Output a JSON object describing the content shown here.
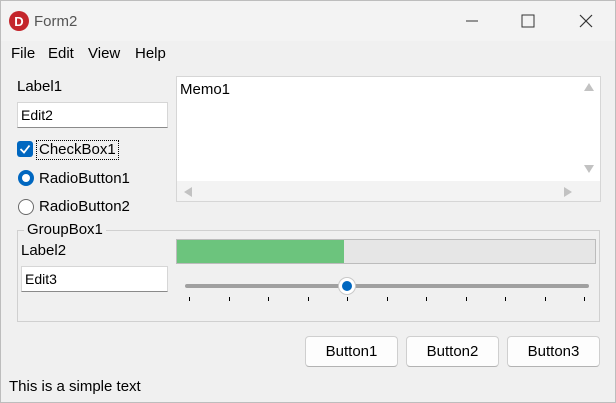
{
  "window": {
    "title": "Form2",
    "app_icon": "D"
  },
  "menu": [
    "File",
    "Edit",
    "View",
    "Help"
  ],
  "label1": "Label1",
  "edit2": "Edit2",
  "checkbox1": {
    "label": "CheckBox1",
    "checked": true
  },
  "radio1": {
    "label": "RadioButton1",
    "selected": true
  },
  "radio2": {
    "label": "RadioButton2",
    "selected": false
  },
  "memo": {
    "text": "Memo1"
  },
  "groupbox": {
    "title": "GroupBox1",
    "label2": "Label2",
    "edit3": "Edit3",
    "progress_fraction": 0.4,
    "slider_fraction": 0.4,
    "slider_ticks": 11
  },
  "buttons": [
    "Button1",
    "Button2",
    "Button3"
  ],
  "status_text": "This is a simple text",
  "colors": {
    "accent": "#0067c0",
    "progress": "#6cc47d",
    "app_icon": "#c4252b"
  }
}
